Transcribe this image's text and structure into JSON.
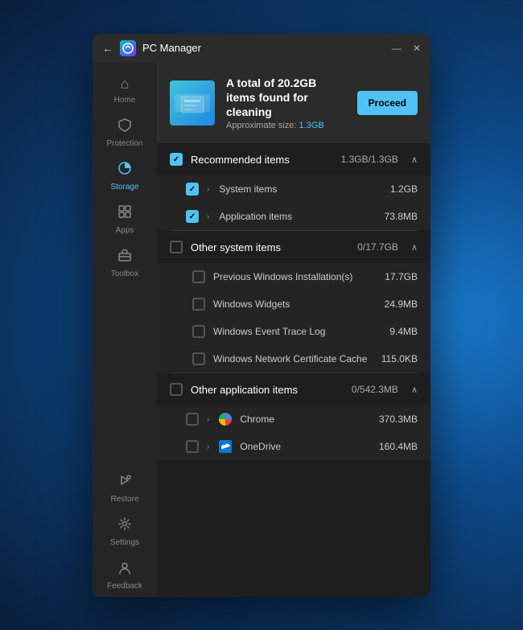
{
  "titlebar": {
    "title": "PC Manager",
    "back_label": "←",
    "minimize_label": "—",
    "close_label": "✕"
  },
  "sidebar": {
    "items": [
      {
        "id": "home",
        "label": "Home",
        "icon": "⌂",
        "active": false
      },
      {
        "id": "protection",
        "label": "Protection",
        "icon": "🛡",
        "active": false
      },
      {
        "id": "storage",
        "label": "Storage",
        "icon": "◉",
        "active": true
      },
      {
        "id": "apps",
        "label": "Apps",
        "icon": "⊞",
        "active": false
      },
      {
        "id": "toolbox",
        "label": "Toolbox",
        "icon": "⊡",
        "active": false
      }
    ],
    "bottom_items": [
      {
        "id": "restore",
        "label": "Restore",
        "icon": "🔑",
        "active": false
      },
      {
        "id": "settings",
        "label": "Settings",
        "icon": "⚙",
        "active": false
      },
      {
        "id": "feedback",
        "label": "Feedback",
        "icon": "👤",
        "active": false
      }
    ]
  },
  "banner": {
    "title": "A total of 20.2GB items found for cleaning",
    "size_label": "Approximate size: ",
    "size_value": "1.3GB",
    "proceed_label": "Proceed"
  },
  "recommended_section": {
    "label": "Recommended items",
    "size": "1.3GB/1.3GB",
    "checked": true,
    "subitems": [
      {
        "label": "System items",
        "size": "1.2GB",
        "checked": true,
        "expandable": true
      },
      {
        "label": "Application items",
        "size": "73.8MB",
        "checked": true,
        "expandable": true
      }
    ]
  },
  "other_system_section": {
    "label": "Other system items",
    "size": "0/17.7GB",
    "checked": false,
    "subitems": [
      {
        "label": "Previous Windows Installation(s)",
        "size": "17.7GB",
        "checked": false
      },
      {
        "label": "Windows Widgets",
        "size": "24.9MB",
        "checked": false
      },
      {
        "label": "Windows Event Trace Log",
        "size": "9.4MB",
        "checked": false
      },
      {
        "label": "Windows Network Certificate Cache",
        "size": "115.0KB",
        "checked": false
      }
    ]
  },
  "other_app_section": {
    "label": "Other application items",
    "size": "0/542.3MB",
    "checked": false,
    "subitems": [
      {
        "label": "Chrome",
        "size": "370.3MB",
        "checked": false,
        "expandable": true,
        "app_icon": "chrome"
      },
      {
        "label": "OneDrive",
        "size": "160.4MB",
        "checked": false,
        "expandable": true,
        "app_icon": "onedrive"
      }
    ]
  }
}
